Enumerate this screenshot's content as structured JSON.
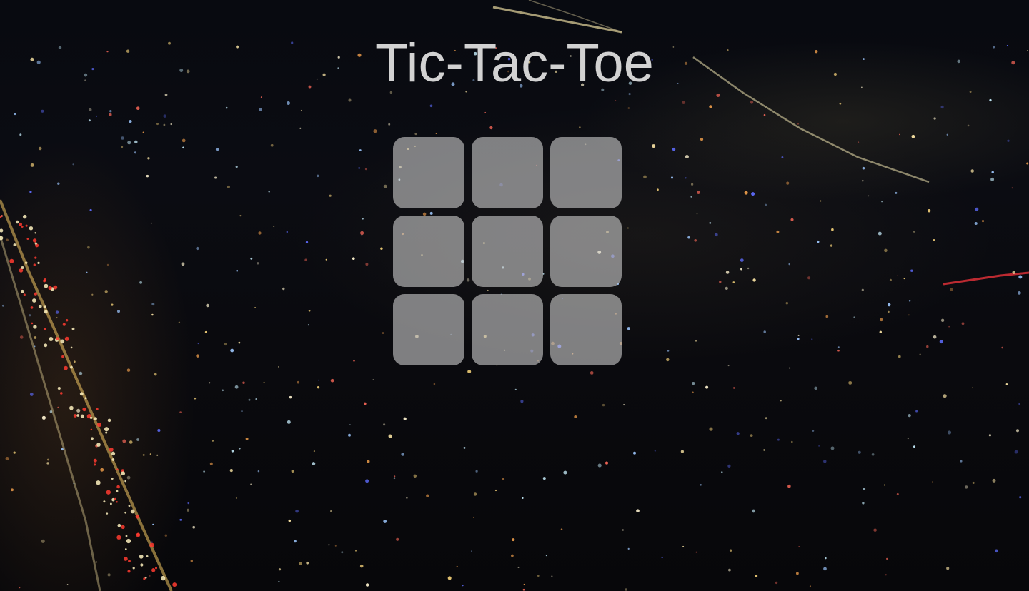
{
  "title": "Tic-Tac-Toe",
  "board": {
    "cells": [
      "",
      "",
      "",
      "",
      "",
      "",
      "",
      "",
      ""
    ]
  }
}
